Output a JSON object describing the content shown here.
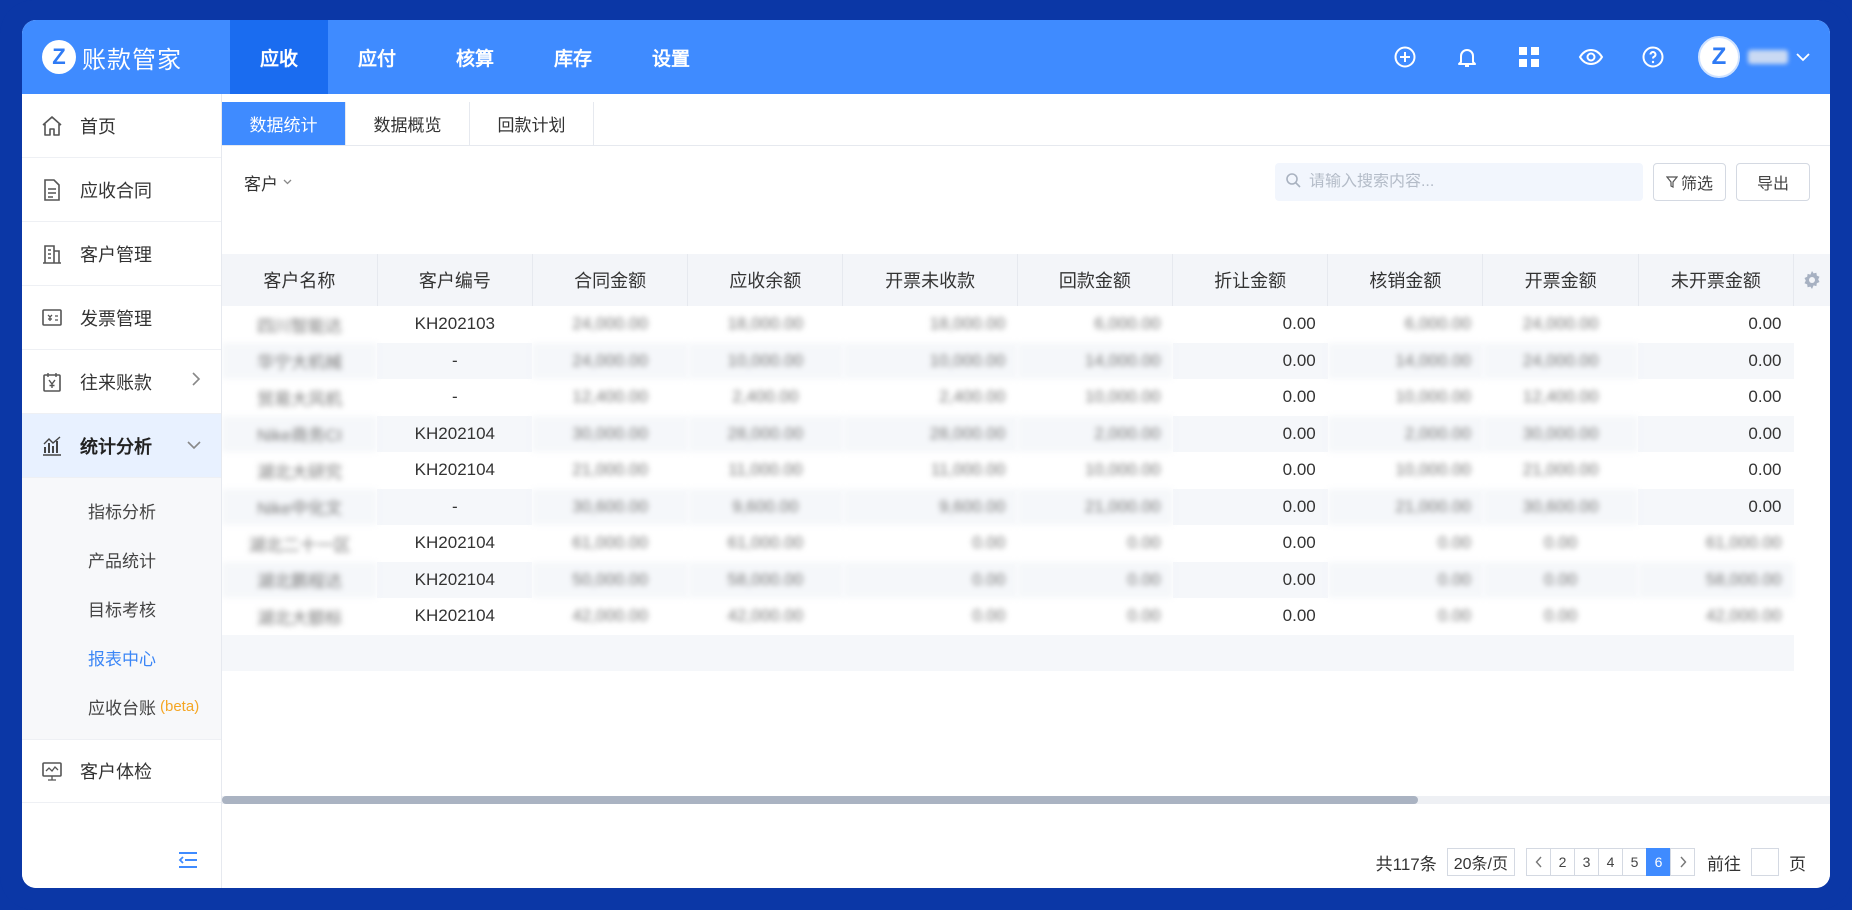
{
  "app": {
    "logo_letter": "Z",
    "title": "账款管家"
  },
  "nav": [
    {
      "label": "应收",
      "active": true
    },
    {
      "label": "应付"
    },
    {
      "label": "核算"
    },
    {
      "label": "库存"
    },
    {
      "label": "设置"
    }
  ],
  "user": {
    "avatar_letter": "Z"
  },
  "sidebar": {
    "items": [
      {
        "label": "首页",
        "icon": "home-icon"
      },
      {
        "label": "应收合同",
        "icon": "document-icon"
      },
      {
        "label": "客户管理",
        "icon": "building-icon"
      },
      {
        "label": "发票管理",
        "icon": "invoice-icon"
      },
      {
        "label": "往来账款",
        "icon": "yen-icon"
      },
      {
        "label": "统计分析",
        "icon": "chart-icon"
      }
    ],
    "sub_items": [
      {
        "label": "指标分析"
      },
      {
        "label": "产品统计"
      },
      {
        "label": "目标考核"
      },
      {
        "label": "报表中心",
        "active": true
      },
      {
        "label": "应收台账",
        "badge": "(beta)"
      }
    ],
    "bottom_item": {
      "label": "客户体检",
      "icon": "monitor-icon"
    }
  },
  "subtabs": [
    {
      "label": "数据统计",
      "active": true
    },
    {
      "label": "数据概览"
    },
    {
      "label": "回款计划"
    }
  ],
  "toolbar": {
    "filter_label": "客户",
    "search_placeholder": "请输入搜索内容...",
    "filter_button": "筛选",
    "export_button": "导出"
  },
  "table": {
    "columns": [
      "客户名称",
      "客户编号",
      "合同金额",
      "应收余额",
      "开票未收款",
      "回款金额",
      "折让金额",
      "核销金额",
      "开票金额",
      "未开票金额"
    ],
    "rows": [
      [
        "四川智能达",
        "KH202103",
        "24,000.00",
        "18,000.00",
        "18,000.00",
        "6,000.00",
        "0.00",
        "6,000.00",
        "24,000.00",
        "0.00"
      ],
      [
        "华宁大机械",
        "-",
        "24,000.00",
        "10,000.00",
        "10,000.00",
        "14,000.00",
        "0.00",
        "14,000.00",
        "24,000.00",
        "0.00"
      ],
      [
        "贸易大风机",
        "-",
        "12,400.00",
        "2,400.00",
        "2,400.00",
        "10,000.00",
        "0.00",
        "10,000.00",
        "12,400.00",
        "0.00"
      ],
      [
        "Nike商务CI",
        "KH202104",
        "30,000.00",
        "28,000.00",
        "28,000.00",
        "2,000.00",
        "0.00",
        "2,000.00",
        "30,000.00",
        "0.00"
      ],
      [
        "湖北大研究",
        "KH202104",
        "21,000.00",
        "11,000.00",
        "11,000.00",
        "10,000.00",
        "0.00",
        "10,000.00",
        "21,000.00",
        "0.00"
      ],
      [
        "Nike中化文",
        "-",
        "30,600.00",
        "9,600.00",
        "9,600.00",
        "21,000.00",
        "0.00",
        "21,000.00",
        "30,600.00",
        "0.00"
      ],
      [
        "湖北二十一区",
        "KH202104",
        "61,000.00",
        "61,000.00",
        "0.00",
        "0.00",
        "0.00",
        "0.00",
        "0.00",
        "61,000.00"
      ],
      [
        "湖北鹏程达",
        "KH202104",
        "50,000.00",
        "58,000.00",
        "0.00",
        "0.00",
        "0.00",
        "0.00",
        "0.00",
        "58,000.00"
      ],
      [
        "湖北大额标",
        "KH202104",
        "42,000.00",
        "42,000.00",
        "0.00",
        "0.00",
        "0.00",
        "0.00",
        "0.00",
        "42,000.00"
      ]
    ]
  },
  "pagination": {
    "total": "共117条",
    "page_size": "20条/页",
    "pages": [
      "2",
      "3",
      "4",
      "5",
      "6"
    ],
    "current_page": "6",
    "goto_label": "前往",
    "page_suffix": "页"
  }
}
